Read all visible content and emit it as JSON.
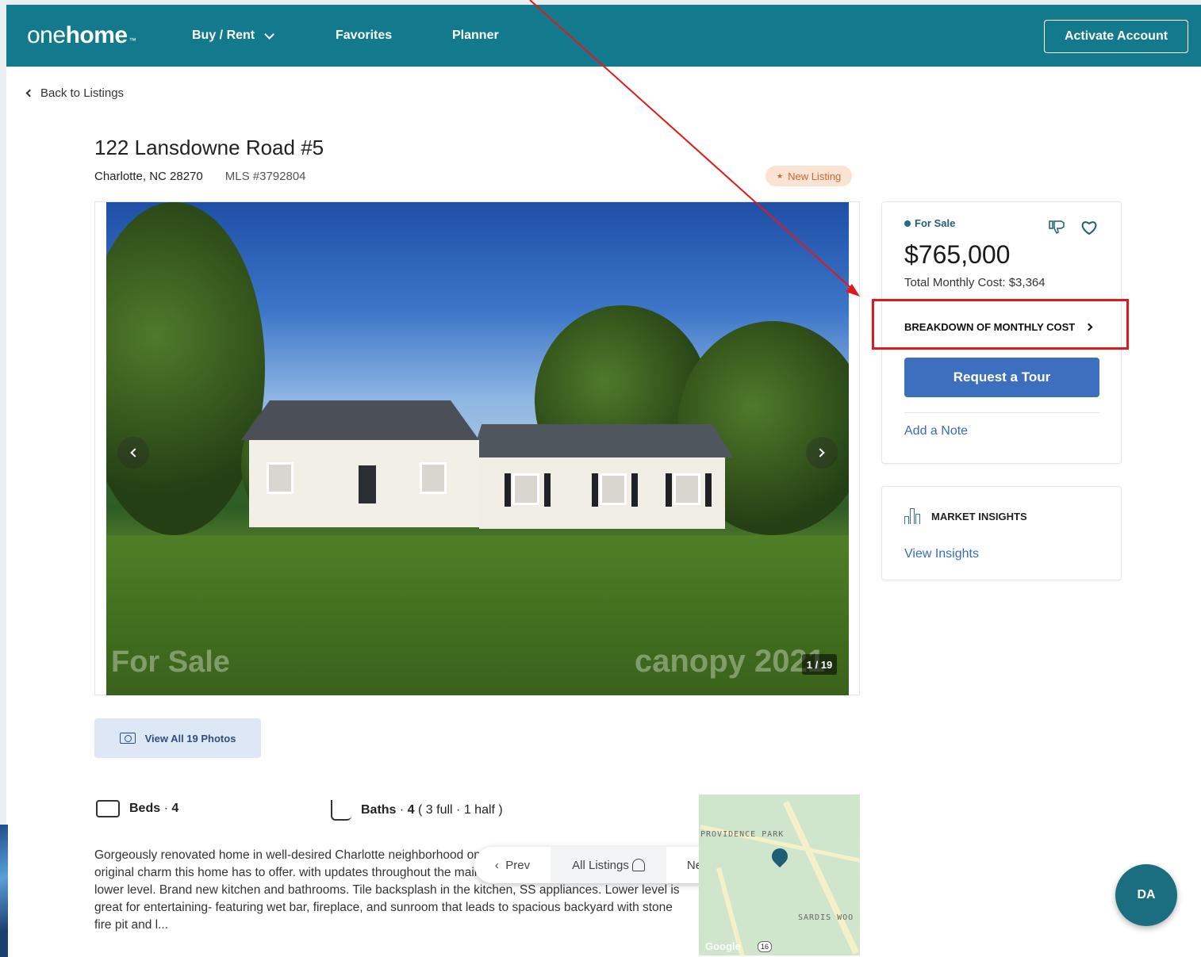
{
  "nav": {
    "logo_thin": "one",
    "logo_bold": "home",
    "logo_tm": "™",
    "items": [
      {
        "label": "Buy / Rent",
        "has_dropdown": true
      },
      {
        "label": "Favorites"
      },
      {
        "label": "Planner"
      }
    ],
    "activate_label": "Activate Account",
    "color": "#127a8c"
  },
  "back_label": "Back to Listings",
  "listing": {
    "address": "122 Lansdowne Road #5",
    "city_state_zip": "Charlotte, NC 28270",
    "mls": "MLS #3792804",
    "badge": "New Listing",
    "photo_counter": "1 / 19",
    "watermark_left": "For Sale",
    "watermark_right": "canopy 2021",
    "view_photos_label": "View All 19 Photos",
    "beds_label": "Beds",
    "beds_value": "4",
    "baths_label": "Baths",
    "baths_value": "4",
    "baths_detail": "( 3 full · 1 half )",
    "description": "Gorgeously renovated home in well-desired Charlotte neighborhood on a generous lot of land. Enjoy all the original charm this home has to offer. with updates throughout the main level. New laminate flooring on lower level. Brand new kitchen and bathrooms. Tile backsplash in the kitchen, SS appliances. Lower level is great for entertaining- featuring wet bar, fireplace, and sunroom that leads to spacious backyard with stone fire pit and l..."
  },
  "pager": {
    "prev": "Prev",
    "all": "All Listings",
    "next": "Next"
  },
  "map": {
    "label_top": "PROVIDENCE PARK",
    "label_bottom": "SARDIS WOO",
    "google": "Google",
    "route": "16"
  },
  "price_card": {
    "status": "For Sale",
    "price": "$765,000",
    "monthly": "Total Monthly Cost: $3,364",
    "breakdown": "BREAKDOWN OF MONTHLY COST",
    "tour_button": "Request a Tour",
    "add_note": "Add a Note"
  },
  "insights_card": {
    "heading": "MARKET INSIGHTS",
    "link": "View Insights"
  },
  "avatar_initials": "DA",
  "annotation_color": "#e01a1a"
}
